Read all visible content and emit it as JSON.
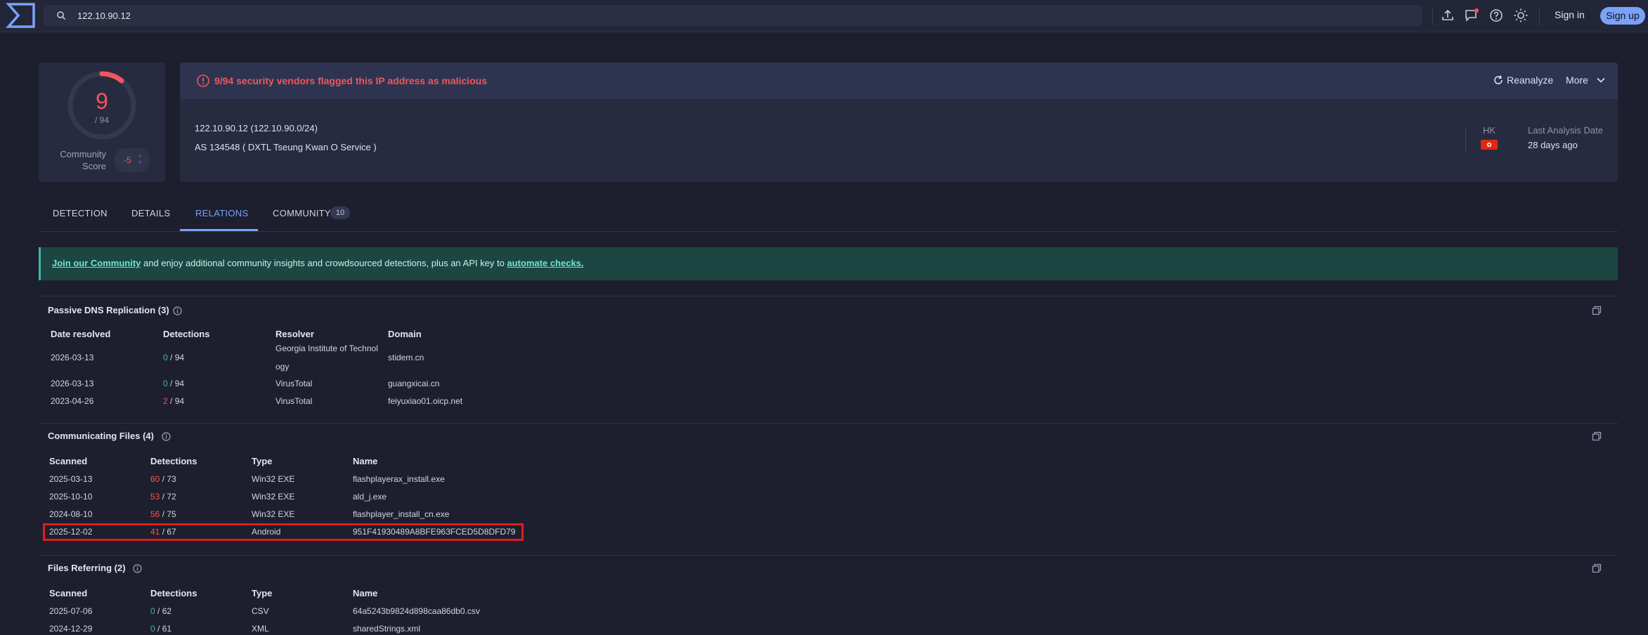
{
  "search": {
    "value": "122.10.90.12"
  },
  "topbar": {
    "sign_in": "Sign in",
    "sign_up": "Sign up"
  },
  "score": {
    "value": "9",
    "total": "/ 94",
    "community_label_1": "Community",
    "community_label_2": "Score",
    "community_value": "-5"
  },
  "header": {
    "alert": "9/94 security vendors flagged this IP address as malicious",
    "reanalyze": "Reanalyze",
    "more": "More",
    "ip_line": "122.10.90.12  (122.10.90.0/24)",
    "as_line": "AS 134548   ( DXTL Tseung Kwan O Service )",
    "country": "HK",
    "last_analysis_label": "Last Analysis Date",
    "last_analysis_value": "28 days ago"
  },
  "tabs": [
    {
      "label": "DETECTION"
    },
    {
      "label": "DETAILS"
    },
    {
      "label": "RELATIONS"
    },
    {
      "label": "COMMUNITY",
      "badge": "10"
    }
  ],
  "banner": {
    "link1": "Join our Community",
    "text": " and enjoy additional community insights and crowdsourced detections, plus an API key to ",
    "link2": "automate checks."
  },
  "passive_dns": {
    "title": "Passive DNS Replication  (3)",
    "headers": [
      "Date resolved",
      "Detections",
      "Resolver",
      "Domain"
    ],
    "rows": [
      {
        "date": "2026-03-13",
        "det": "0",
        "tot": " / 94",
        "resolver1": "Georgia Institute of Technol",
        "resolver2": "ogy",
        "domain": "stidem.cn"
      },
      {
        "date": "2026-03-13",
        "det": "0",
        "tot": " / 94",
        "resolver1": "VirusTotal",
        "domain": "guangxicai.cn"
      },
      {
        "date": "2023-04-26",
        "det": "2",
        "tot": " / 94",
        "resolver1": "VirusTotal",
        "domain": "feiyuxiao01.oicp.net"
      }
    ]
  },
  "communicating_files": {
    "title": "Communicating Files  (4)",
    "headers": [
      "Scanned",
      "Detections",
      "Type",
      "Name"
    ],
    "rows": [
      {
        "scanned": "2025-03-13",
        "det": "60",
        "tot": " / 73",
        "type": "Win32 EXE",
        "name": "flashplayerax_install.exe"
      },
      {
        "scanned": "2025-10-10",
        "det": "53",
        "tot": " / 72",
        "type": "Win32 EXE",
        "name": "ald_j.exe"
      },
      {
        "scanned": "2024-08-10",
        "det": "56",
        "tot": " / 75",
        "type": "Win32 EXE",
        "name": "flashplayer_install_cn.exe"
      },
      {
        "scanned": "2025-12-02",
        "det": "41",
        "tot": " / 67",
        "type": "Android",
        "name": "951F41930489A8BFE963FCED5D8DFD79"
      }
    ]
  },
  "files_referring": {
    "title": "Files Referring  (2)",
    "headers": [
      "Scanned",
      "Detections",
      "Type",
      "Name"
    ],
    "rows": [
      {
        "scanned": "2025-07-06",
        "det": "0",
        "tot": " / 62",
        "type": "CSV",
        "name": "64a5243b9824d898caa86db0.csv"
      },
      {
        "scanned": "2024-12-29",
        "det": "0",
        "tot": " / 61",
        "type": "XML",
        "name": "sharedStrings.xml"
      }
    ]
  },
  "colors": {
    "accent": "#7aa2f7",
    "malicious": "#f0565c",
    "clean": "#3fb8a8",
    "highlight": "#e11d1d"
  }
}
